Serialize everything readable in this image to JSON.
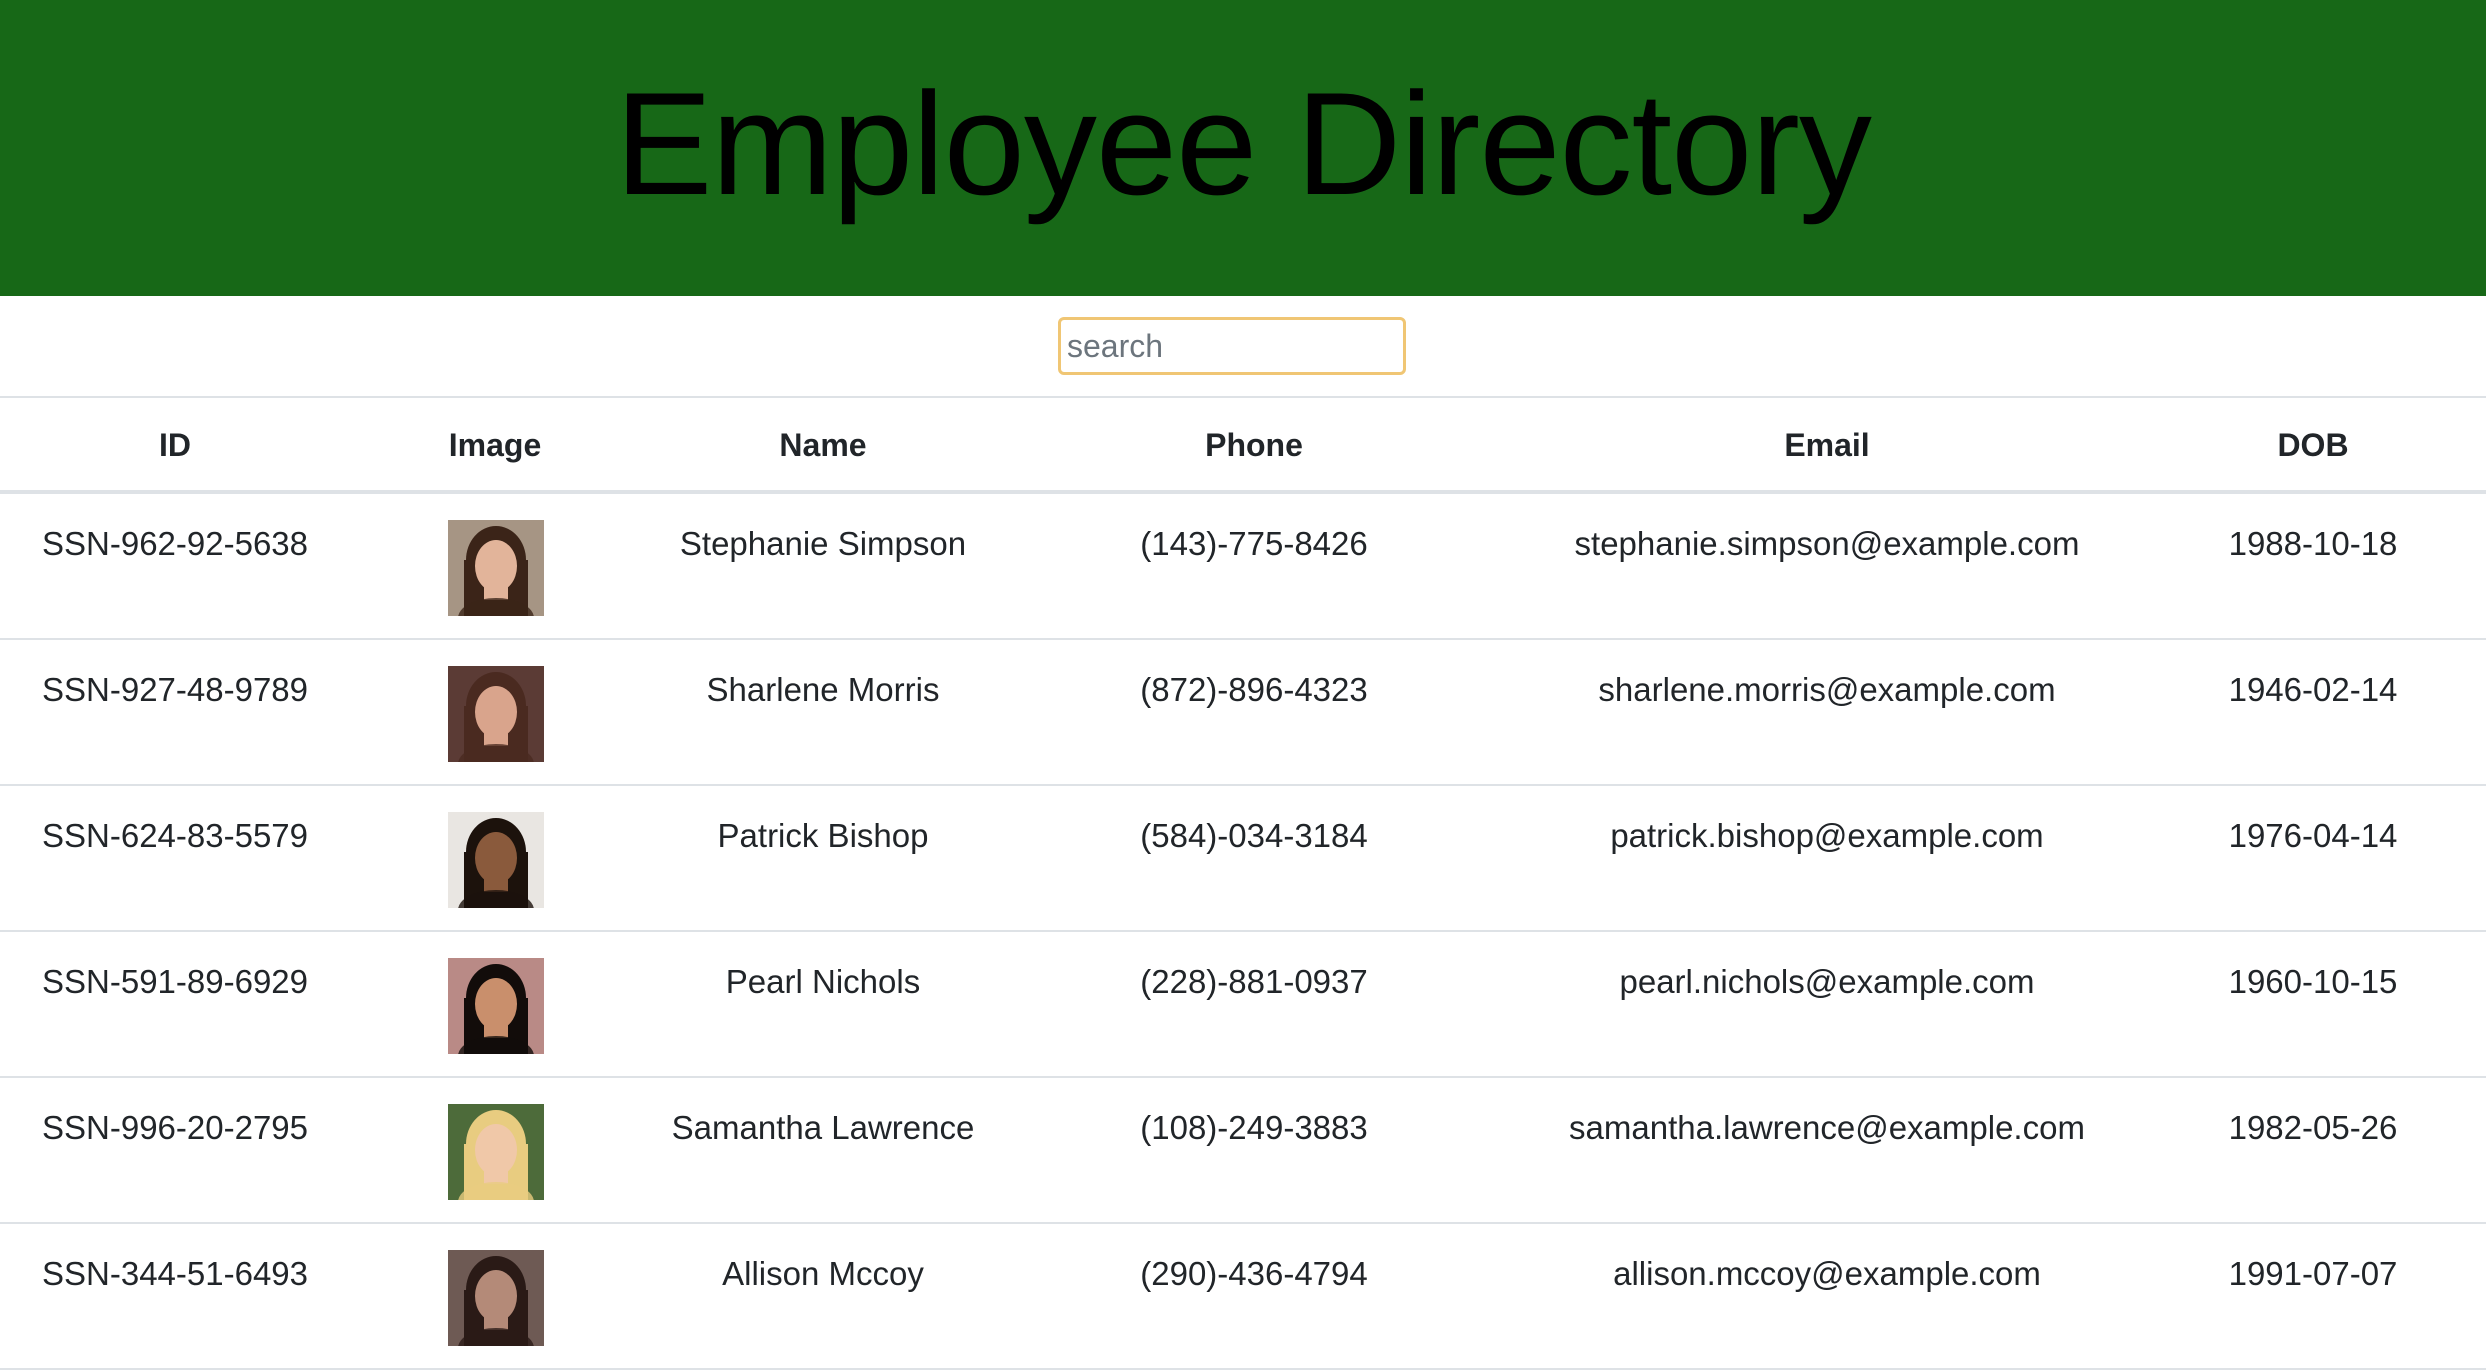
{
  "header": {
    "title": "Employee Directory",
    "bg_color": "#176817"
  },
  "search": {
    "placeholder": "search",
    "value": ""
  },
  "table": {
    "columns": [
      "ID",
      "Image",
      "Name",
      "Phone",
      "Email",
      "DOB"
    ],
    "rows": [
      {
        "id": "SSN-962-92-5638",
        "image": "avatar-photo",
        "name": "Stephanie Simpson",
        "phone": "(143)-775-8426",
        "email": "stephanie.simpson@example.com",
        "dob": "1988-10-18",
        "skin": "#e2b49a",
        "hair": "#3b2418",
        "bg": "#a69584"
      },
      {
        "id": "SSN-927-48-9789",
        "image": "avatar-photo",
        "name": "Sharlene Morris",
        "phone": "(872)-896-4323",
        "email": "sharlene.morris@example.com",
        "dob": "1946-02-14",
        "skin": "#d9a48c",
        "hair": "#4a2a20",
        "bg": "#5b3b35"
      },
      {
        "id": "SSN-624-83-5579",
        "image": "avatar-photo",
        "name": "Patrick Bishop",
        "phone": "(584)-034-3184",
        "email": "patrick.bishop@example.com",
        "dob": "1976-04-14",
        "skin": "#8a5a3c",
        "hair": "#1c120c",
        "bg": "#e9e6e2"
      },
      {
        "id": "SSN-591-89-6929",
        "image": "avatar-photo",
        "name": "Pearl Nichols",
        "phone": "(228)-881-0937",
        "email": "pearl.nichols@example.com",
        "dob": "1960-10-15",
        "skin": "#c98f6c",
        "hair": "#120c0a",
        "bg": "#b98a86"
      },
      {
        "id": "SSN-996-20-2795",
        "image": "avatar-photo",
        "name": "Samantha Lawrence",
        "phone": "(108)-249-3883",
        "email": "samantha.lawrence@example.com",
        "dob": "1982-05-26",
        "skin": "#f0c8a8",
        "hair": "#e8cc80",
        "bg": "#4d6b3a"
      },
      {
        "id": "SSN-344-51-6493",
        "image": "avatar-photo",
        "name": "Allison Mccoy",
        "phone": "(290)-436-4794",
        "email": "allison.mccoy@example.com",
        "dob": "1991-07-07",
        "skin": "#b48a78",
        "hair": "#2a1a16",
        "bg": "#6e5a54"
      }
    ]
  }
}
